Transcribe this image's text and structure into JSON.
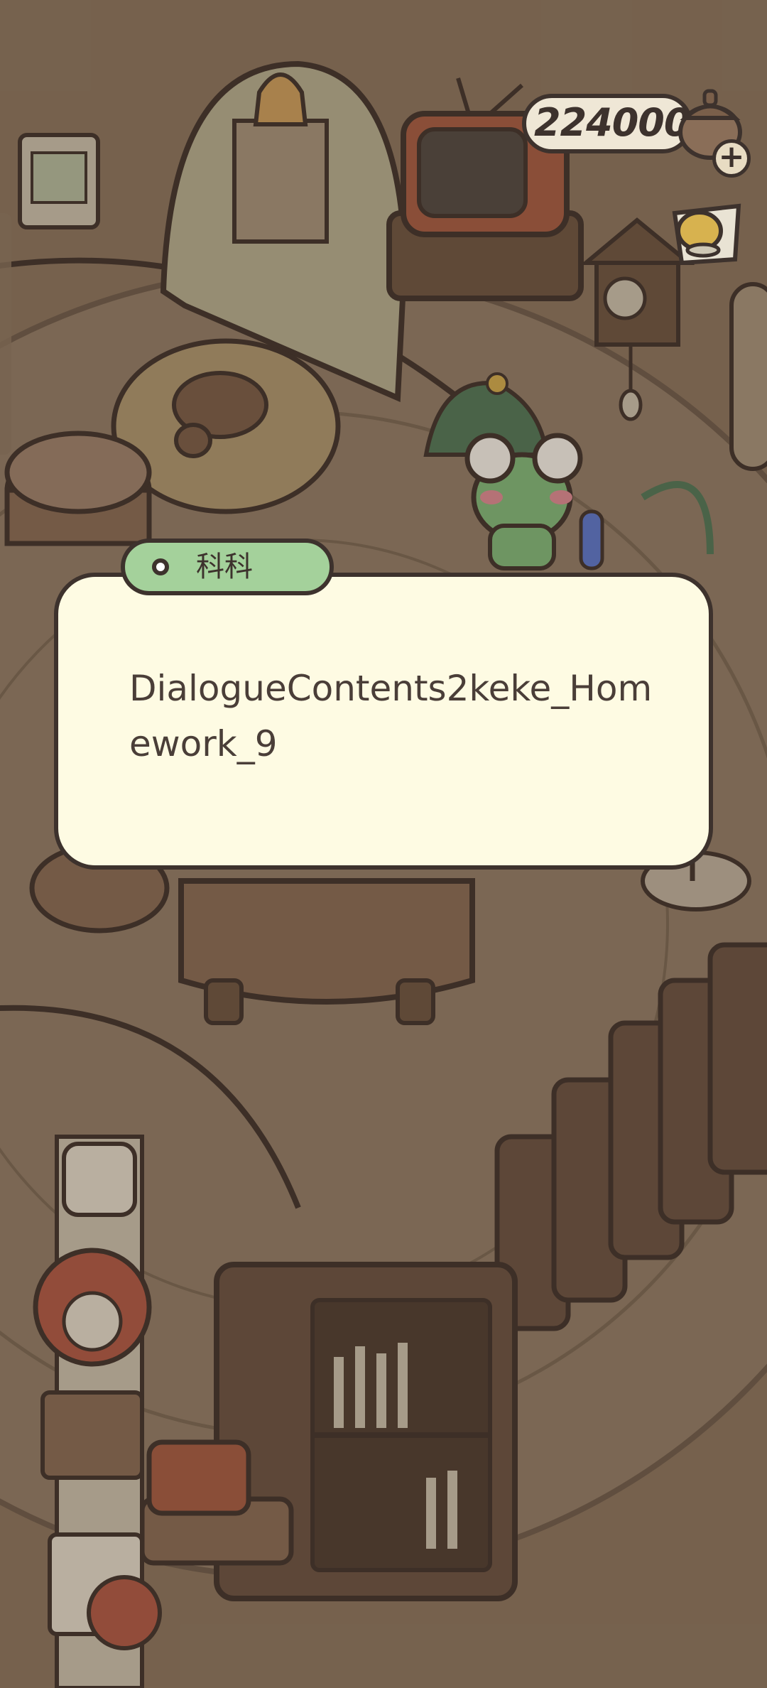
{
  "hud": {
    "coin_count": "224000",
    "add_icon": "plus-icon",
    "shop_icon": "teacup-icon"
  },
  "dialogue": {
    "speaker_name": "科科",
    "text": "DialogueContents2keke_Homework_9"
  },
  "colors": {
    "name_tag": "#a4d19b",
    "dialog_bg": "#fefbe3",
    "outline": "#3d322d",
    "text": "#4a3e38"
  }
}
